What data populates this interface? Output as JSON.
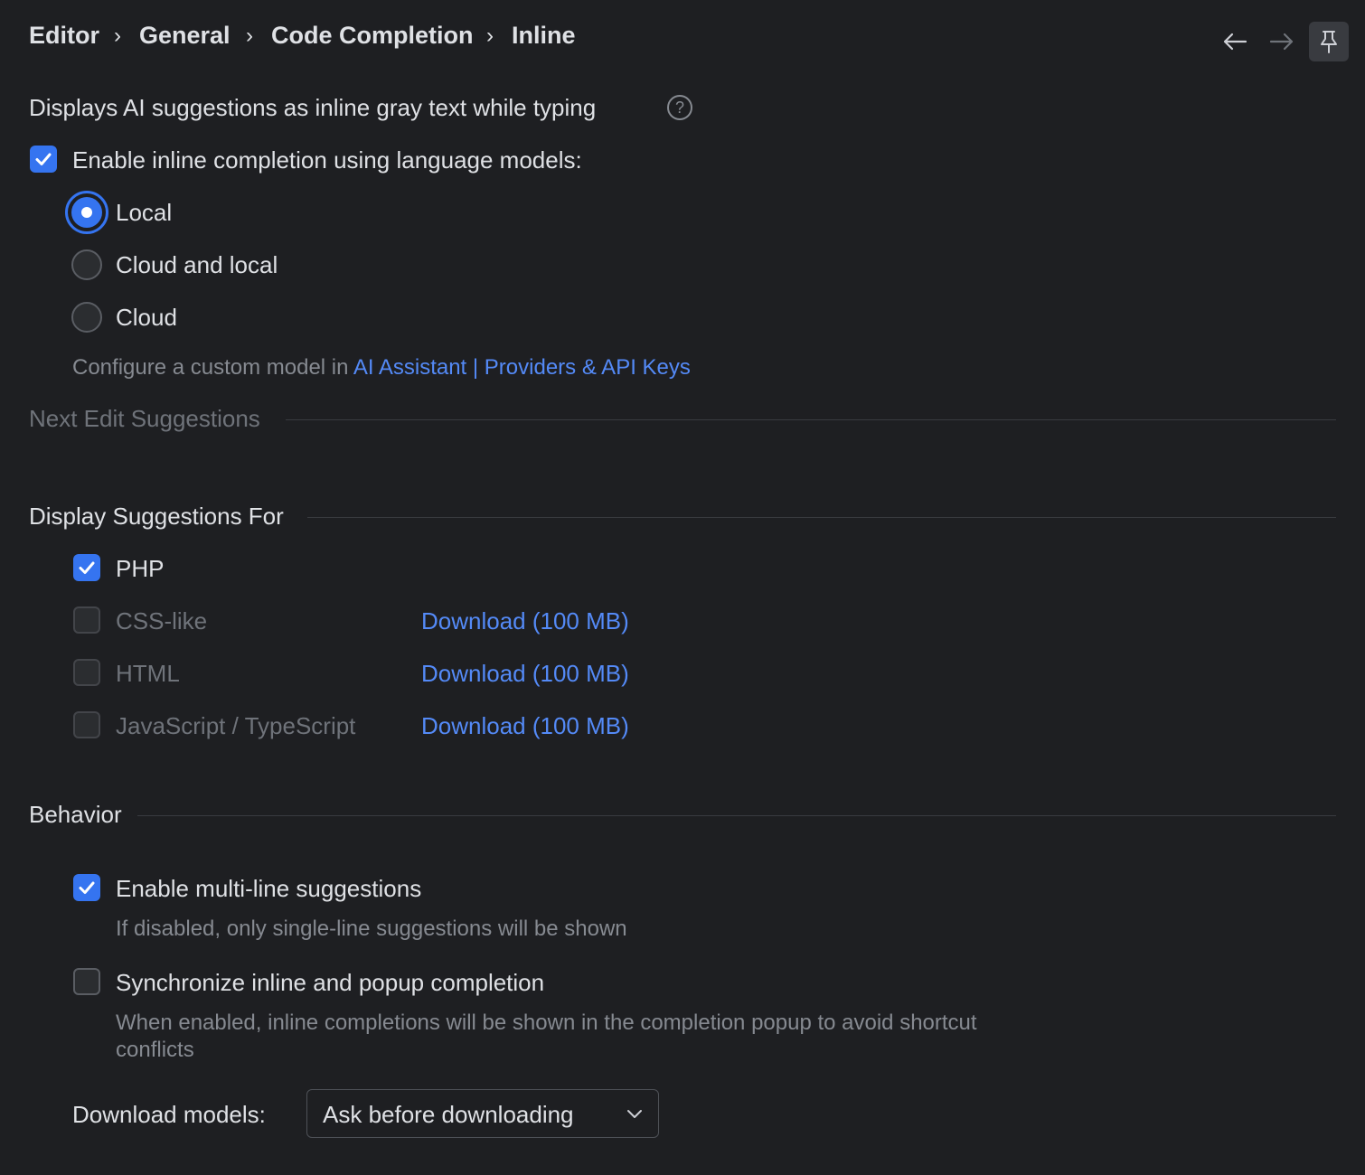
{
  "breadcrumb": {
    "items": [
      "Editor",
      "General",
      "Code Completion",
      "Inline"
    ],
    "separator": "›"
  },
  "nav": {
    "back_icon": "arrow-left-icon",
    "forward_icon": "arrow-right-icon",
    "pin_icon": "pin-icon"
  },
  "description": "Displays AI suggestions as inline gray text while typing",
  "help_icon_glyph": "?",
  "enable_inline": {
    "label": "Enable inline completion using language models:",
    "checked": true
  },
  "model_options": [
    {
      "label": "Local",
      "selected": true
    },
    {
      "label": "Cloud and local",
      "selected": false
    },
    {
      "label": "Cloud",
      "selected": false
    }
  ],
  "custom_model": {
    "prefix": "Configure a custom model in",
    "link1": "AI Assistant",
    "divider": "|",
    "link2": "Providers & API Keys"
  },
  "sections": {
    "next_edit": "Next Edit Suggestions",
    "display_for": "Display Suggestions For",
    "behavior": "Behavior"
  },
  "languages": [
    {
      "label": "PHP",
      "checked": true,
      "enabled": true,
      "action": ""
    },
    {
      "label": "CSS-like",
      "checked": false,
      "enabled": false,
      "action": "Download (100 MB)"
    },
    {
      "label": "HTML",
      "checked": false,
      "enabled": false,
      "action": "Download (100 MB)"
    },
    {
      "label": "JavaScript / TypeScript",
      "checked": false,
      "enabled": false,
      "action": "Download (100 MB)"
    }
  ],
  "behavior": {
    "multiline": {
      "label": "Enable multi-line suggestions",
      "hint": "If disabled, only single-line suggestions will be shown",
      "checked": true
    },
    "sync": {
      "label": "Synchronize inline and popup completion",
      "hint_line1": "When enabled, inline completions will be shown in the completion popup to avoid shortcut",
      "hint_line2": "conflicts",
      "checked": false
    }
  },
  "download_models": {
    "label": "Download models:",
    "value": "Ask before downloading"
  },
  "colors": {
    "background": "#1e1f22",
    "accent": "#3574f0",
    "link": "#548af7",
    "text": "#dfe1e5",
    "muted": "#6f737a"
  }
}
